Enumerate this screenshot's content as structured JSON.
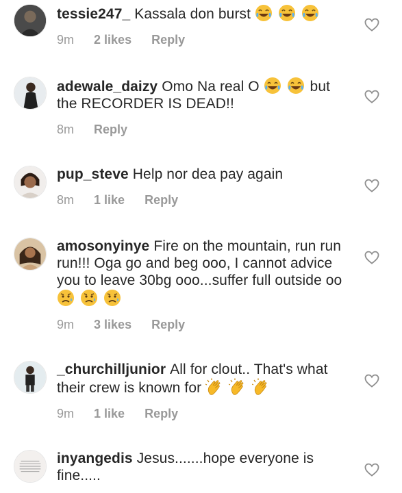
{
  "comments": [
    {
      "username": "tessie247_",
      "text": "Kassala don burst",
      "emojis": [
        "laughing-tears",
        "laughing-tears",
        "laughing-tears"
      ],
      "text_after": "",
      "time": "9m",
      "likes": "2 likes",
      "reply": "Reply"
    },
    {
      "username": "adewale_daizy",
      "text": "Omo Na real O",
      "emojis": [
        "laughing-tears",
        "laughing-tears"
      ],
      "text_after": "but the RECORDER IS DEAD!!",
      "time": "8m",
      "likes": "",
      "reply": "Reply"
    },
    {
      "username": "pup_steve",
      "text": "Help nor dea pay again",
      "emojis": [],
      "text_after": "",
      "time": "8m",
      "likes": "1 like",
      "reply": "Reply"
    },
    {
      "username": "amosonyinye",
      "text": "Fire on the mountain, run run run!!! Oga go and beg ooo, I cannot advice you to leave 30bg ooo...suffer full outside oo",
      "emojis": [
        "sad-sweat",
        "sad-sweat",
        "sad-sweat"
      ],
      "text_after": "",
      "time": "9m",
      "likes": "3 likes",
      "reply": "Reply"
    },
    {
      "username": "_churchilljunior",
      "text": "All for clout.. That's what their crew is known for",
      "emojis": [
        "clapping-hands",
        "clapping-hands",
        "clapping-hands"
      ],
      "text_after": "",
      "time": "9m",
      "likes": "1 like",
      "reply": "Reply"
    },
    {
      "username": "inyangedis",
      "text": "Jesus.......hope everyone is fine.....",
      "emojis": [],
      "text_after": "",
      "time": "",
      "likes": "",
      "reply": ""
    }
  ],
  "icons": {
    "like": "heart-outline-icon"
  },
  "colors": {
    "text": "#262626",
    "meta": "#999999",
    "heart": "#8e8e8e",
    "emoji_face": "#f7c23a"
  }
}
